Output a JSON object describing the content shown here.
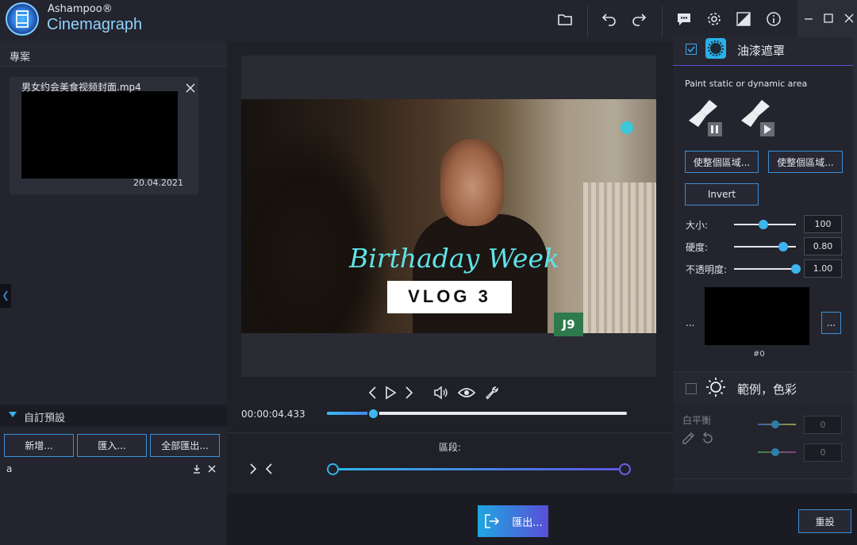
{
  "app": {
    "brand_top": "Ashampoo®",
    "brand_main": "Cinemagraph"
  },
  "toolbar": {
    "icons": [
      "folder-icon",
      "undo-icon",
      "redo-icon",
      "feedback-icon",
      "gear-icon",
      "theme-icon",
      "info-icon"
    ]
  },
  "window_controls": [
    "minimize",
    "maximize",
    "close"
  ],
  "project": {
    "title": "專案",
    "media": {
      "filename": "男女约会美食视频封面.mp4",
      "date": "20.04.2021"
    }
  },
  "presets": {
    "title": "自訂預設",
    "buttons": [
      "新增...",
      "匯入...",
      "全部匯出..."
    ],
    "items": [
      {
        "label": "a"
      }
    ]
  },
  "preview": {
    "overlay_script": "Birthaday Week",
    "overlay_box": "VLOG 3",
    "watermark": "J9"
  },
  "playback": {
    "time": "00:00:04.433",
    "progress_fraction": 0.155
  },
  "segment": {
    "label": "區段:",
    "start_fraction": 0.0,
    "end_fraction": 1.0
  },
  "mask_panel": {
    "title": "油漆遮罩",
    "checked": true,
    "paint_label": "Paint static or dynamic area",
    "fill_buttons": [
      "使整個區域...",
      "使整個區域..."
    ],
    "invert_label": "Invert",
    "sliders": [
      {
        "label": "大小:",
        "value": "100",
        "fraction": 0.48
      },
      {
        "label": "硬度:",
        "value": "0.80",
        "fraction": 0.8
      },
      {
        "label": "不透明度:",
        "value": "1.00",
        "fraction": 1.0
      }
    ],
    "ellipsis_left": "...",
    "more_button": "...",
    "index": "#0"
  },
  "color_panel": {
    "title": "範例，色彩",
    "checked": false,
    "white_balance_label": "白平衡",
    "values": [
      "0",
      "0"
    ]
  },
  "footer": {
    "export_label": "匯出...",
    "reset_label": "重設"
  },
  "colors": {
    "accent": "#3aa6f0",
    "accent_purple": "#5a4fd8",
    "background": "#1a1b22",
    "panel": "#23242d"
  }
}
